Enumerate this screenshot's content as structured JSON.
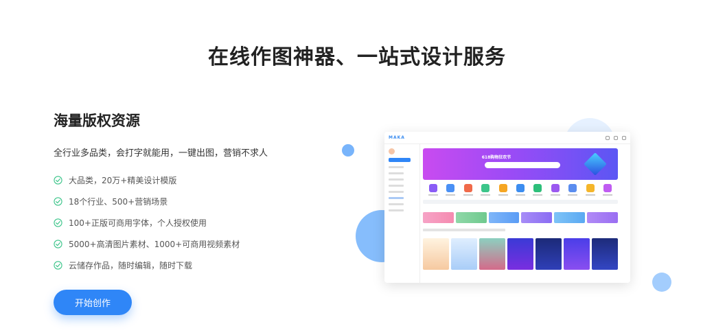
{
  "header": {
    "title": "在线作图神器、一站式设计服务"
  },
  "section": {
    "title": "海量版权资源",
    "subtitle": "全行业多品类，会打字就能用，一键出图，营销不求人",
    "features": [
      "大品类，20万+精美设计模版",
      "18个行业、500+营销场景",
      "100+正版可商用字体，个人授权使用",
      "5000+高清图片素材、1000+可商用视频素材",
      "云储存作品，随时编辑，随时下载"
    ],
    "cta_label": "开始创作"
  },
  "colors": {
    "accent": "#2f86f7",
    "check": "#3cc58a"
  },
  "preview": {
    "logo": "MAKA",
    "banner_title": "618购物狂欢节"
  }
}
